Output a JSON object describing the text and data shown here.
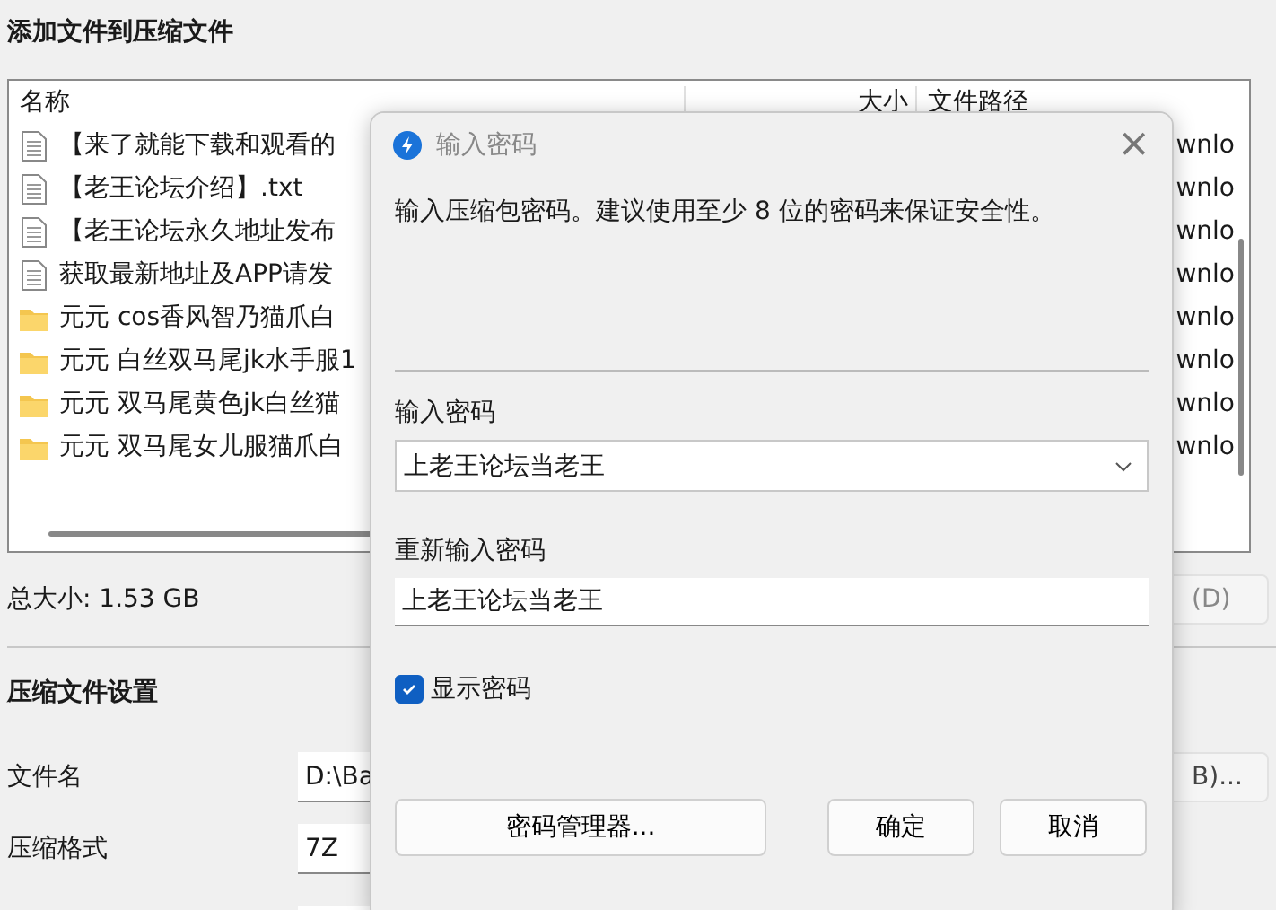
{
  "window": {
    "title": "添加文件到压缩文件"
  },
  "file_list": {
    "columns": [
      "名称",
      "大小",
      "文件路径"
    ],
    "rows": [
      {
        "kind": "file",
        "name": "【来了就能下载和观看的",
        "path": "wnlo"
      },
      {
        "kind": "file",
        "name": "【老王论坛介绍】.txt",
        "path": "wnlo"
      },
      {
        "kind": "file",
        "name": "【老王论坛永久地址发布",
        "path": "wnlo"
      },
      {
        "kind": "file",
        "name": "获取最新地址及APP请发",
        "path": "wnlo"
      },
      {
        "kind": "folder",
        "name": "元元 cos香风智乃猫爪白",
        "path": "wnlo"
      },
      {
        "kind": "folder",
        "name": "元元 白丝双马尾jk水手服1",
        "path": "wnlo"
      },
      {
        "kind": "folder",
        "name": "元元 双马尾黄色jk白丝猫",
        "path": "wnlo"
      },
      {
        "kind": "folder",
        "name": "元元 双马尾女儿服猫爪白",
        "path": "wnlo"
      }
    ]
  },
  "total_size": "总大小: 1.53 GB",
  "delete_button": "(D)",
  "settings": {
    "title": "压缩文件设置",
    "file_name": {
      "label": "文件名",
      "value": "D:\\Ba",
      "button": "B)..."
    },
    "format": {
      "label": "压缩格式",
      "value": "7Z"
    }
  },
  "dialog": {
    "title": "输入密码",
    "close": "×",
    "description": "输入压缩包密码。建议使用至少 8 位的密码来保证安全性。",
    "password": {
      "label": "输入密码",
      "value": "上老王论坛当老王"
    },
    "confirm": {
      "label": "重新输入密码",
      "value": "上老王论坛当老王"
    },
    "show_password": {
      "label": "显示密码",
      "checked": true
    },
    "buttons": [
      "密码管理器...",
      "确定",
      "取消"
    ]
  }
}
